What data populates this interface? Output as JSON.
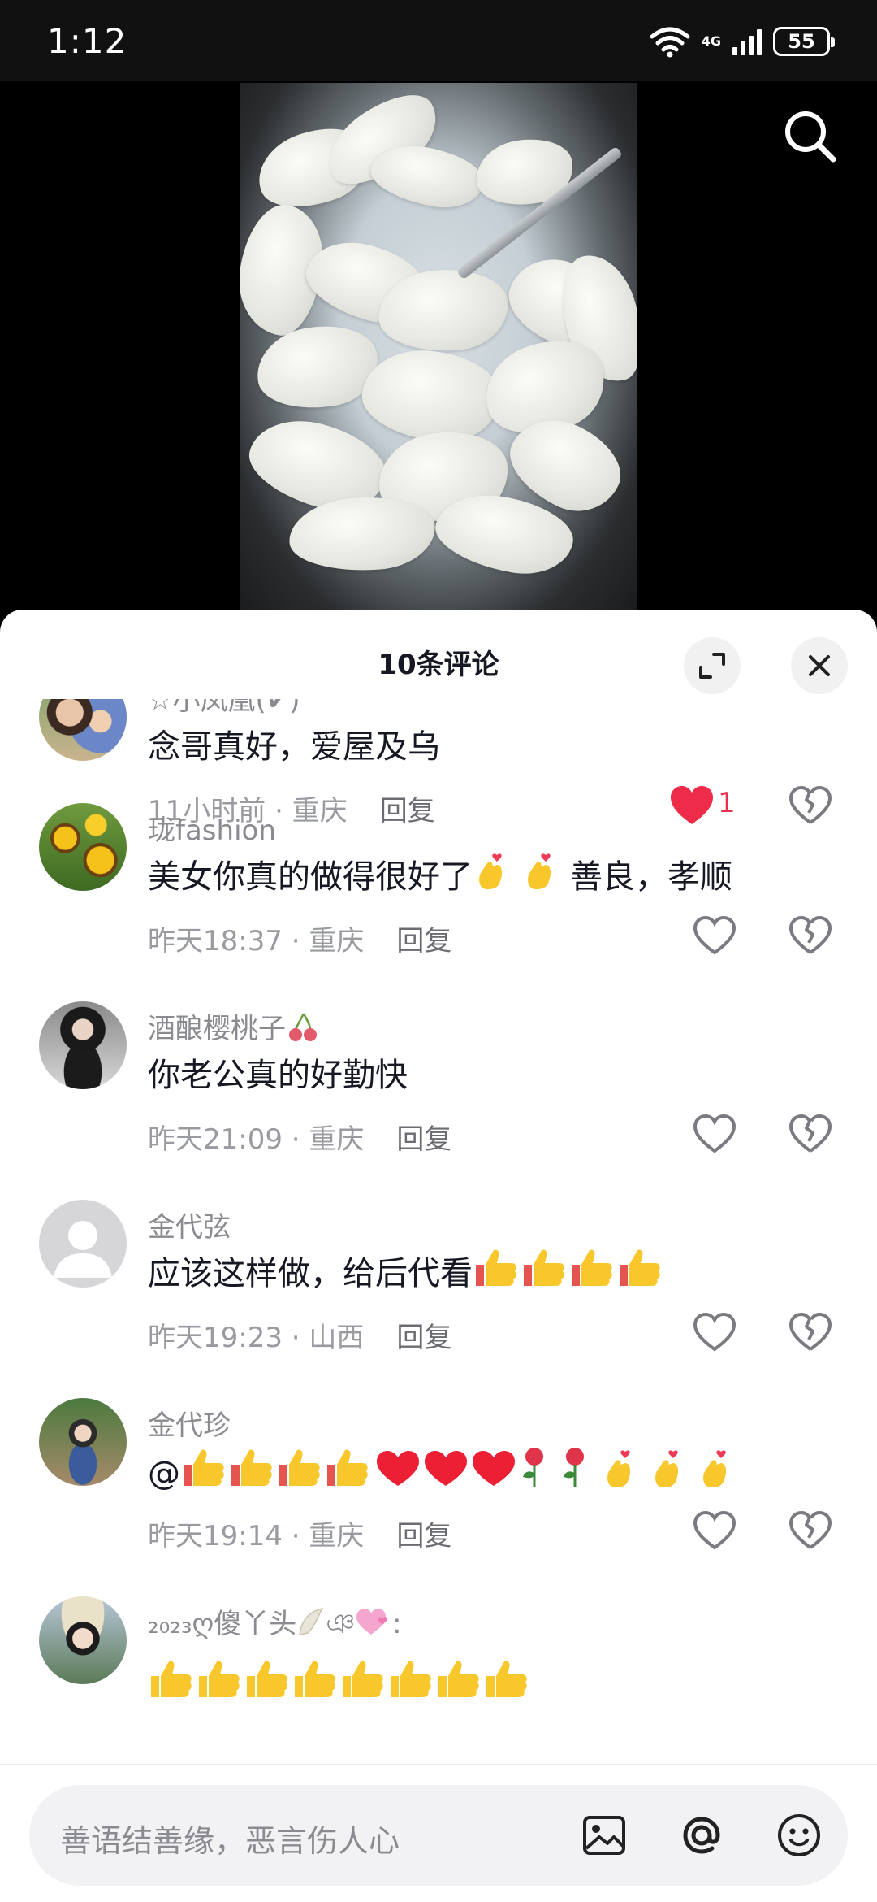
{
  "status_bar": {
    "time": "1:12",
    "network": "4G",
    "battery": "55"
  },
  "sheet": {
    "title": "10条评论"
  },
  "comments": [
    {
      "user": "☆小凤凰(✔)",
      "text": "念哥真好，爱屋及乌",
      "time": "11小时前",
      "location": "重庆",
      "reply": "回复",
      "likes": "1",
      "liked": true
    },
    {
      "user": "珑fashion",
      "text": "美女你真的做得很好了",
      "text_tail": "善良，孝顺",
      "time": "昨天18:37",
      "location": "重庆",
      "reply": "回复"
    },
    {
      "user": "酒酿樱桃子",
      "text": "你老公真的好勤快",
      "time": "昨天21:09",
      "location": "重庆",
      "reply": "回复"
    },
    {
      "user": "金代弦",
      "text": "应该这样做，给后代看",
      "time": "昨天19:23",
      "location": "山西",
      "reply": "回复"
    },
    {
      "user": "金代珍",
      "text": "@",
      "time": "昨天19:14",
      "location": "重庆",
      "reply": "回复"
    },
    {
      "user": "₂₀₂₃ღ傻丫头",
      "text": "",
      "time": "",
      "location": "",
      "reply": ""
    }
  ],
  "input": {
    "placeholder": "善语结善缘，恶言伤人心"
  },
  "icons": [
    "search-icon",
    "expand-icon",
    "close-icon",
    "heart-icon",
    "broken-heart-icon",
    "image-icon",
    "at-icon",
    "emoji-icon"
  ]
}
